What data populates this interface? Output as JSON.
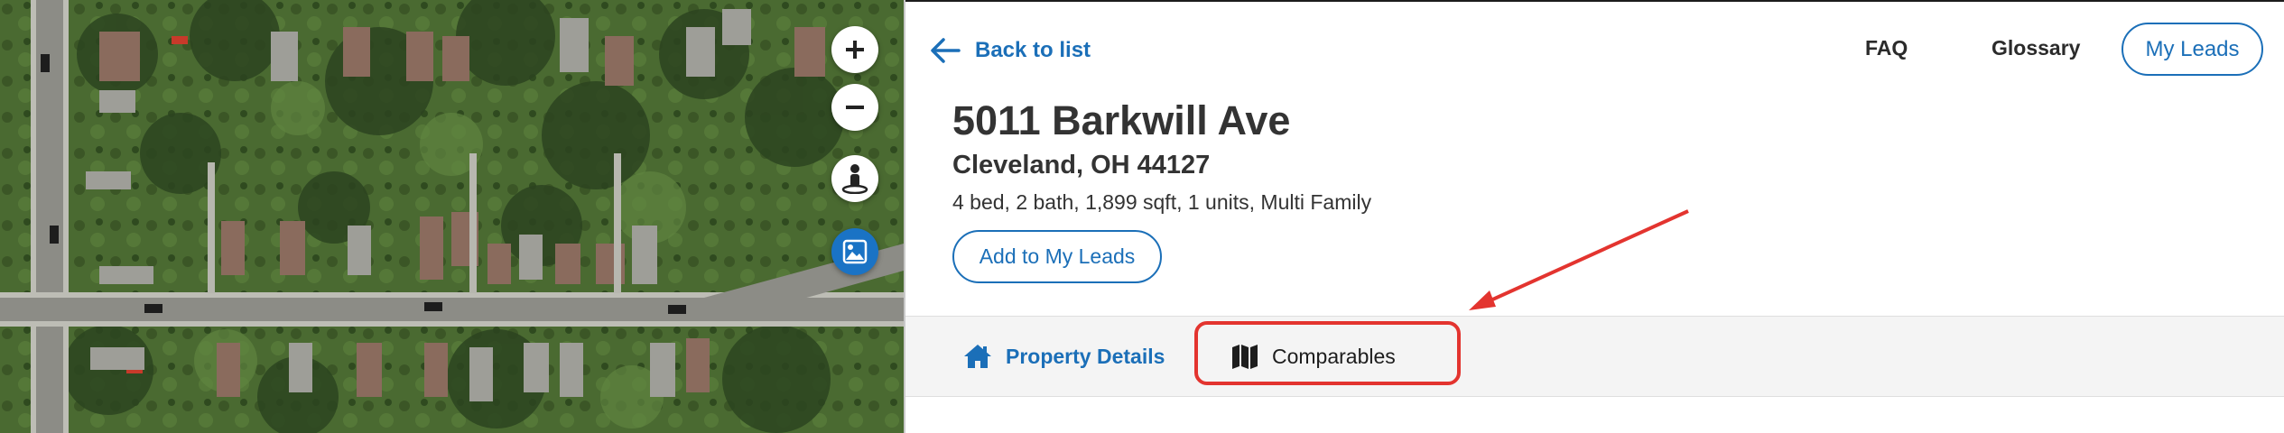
{
  "map": {
    "zoom_in_icon": "plus-icon",
    "zoom_out_icon": "minus-icon",
    "street_view_icon": "pegman-icon",
    "layers_icon": "image-layer-icon",
    "accent": "#1a73c5"
  },
  "header": {
    "back_label": "Back to list",
    "faq_label": "FAQ",
    "glossary_label": "Glossary",
    "my_leads_label": "My Leads"
  },
  "property": {
    "address": "5011 Barkwill Ave",
    "city_state_zip": "Cleveland, OH 44127",
    "summary": "4 bed, 2 bath, 1,899 sqft, 1 units, Multi Family",
    "add_button_label": "Add to My Leads"
  },
  "tabs": [
    {
      "label": "Property Details",
      "icon": "house-icon",
      "active": true
    },
    {
      "label": "Comparables",
      "icon": "map-icon",
      "active": false
    }
  ],
  "annotation": {
    "color": "#e3342f",
    "target": "Comparables"
  },
  "colors": {
    "link_blue": "#1b6fb8",
    "text": "#333333",
    "tab_bg": "#f4f4f4"
  }
}
